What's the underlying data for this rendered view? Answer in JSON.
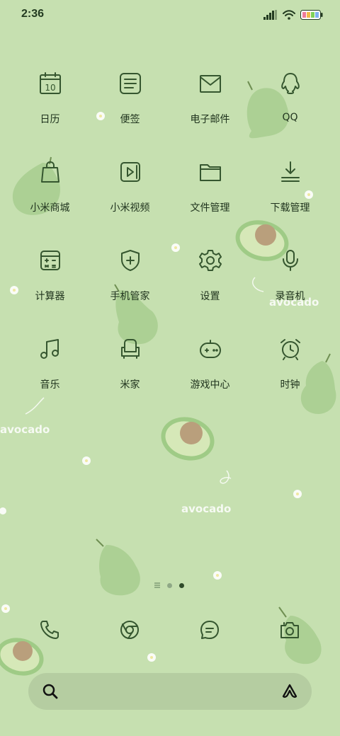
{
  "status_bar": {
    "time": "2:36"
  },
  "apps": [
    {
      "label": "日历",
      "icon": "calendar-icon",
      "badge": "10"
    },
    {
      "label": "便签",
      "icon": "notes-icon"
    },
    {
      "label": "电子邮件",
      "icon": "mail-icon"
    },
    {
      "label": "QQ",
      "icon": "qq-icon"
    },
    {
      "label": "小米商城",
      "icon": "shopping-bag-icon"
    },
    {
      "label": "小米视频",
      "icon": "video-icon"
    },
    {
      "label": "文件管理",
      "icon": "folder-icon"
    },
    {
      "label": "下载管理",
      "icon": "download-icon"
    },
    {
      "label": "计算器",
      "icon": "calculator-icon"
    },
    {
      "label": "手机管家",
      "icon": "shield-icon"
    },
    {
      "label": "设置",
      "icon": "gear-icon"
    },
    {
      "label": "录音机",
      "icon": "microphone-icon"
    },
    {
      "label": "音乐",
      "icon": "music-note-icon"
    },
    {
      "label": "米家",
      "icon": "armchair-icon"
    },
    {
      "label": "游戏中心",
      "icon": "gamepad-icon"
    },
    {
      "label": "时钟",
      "icon": "alarm-clock-icon"
    }
  ],
  "wallpaper_text": {
    "word1": "avocado",
    "word2": "avocado",
    "word3": "avocado"
  },
  "page_indicator": {
    "pages": 3,
    "active": 2
  },
  "dock": [
    "phone-icon",
    "browser-icon",
    "messages-icon",
    "camera-icon"
  ],
  "colors": {
    "background": "#c6e0b0",
    "icon_stroke": "#35562f",
    "avocado": "#a9cf8f",
    "avocado_pit": "#b99f7c"
  }
}
